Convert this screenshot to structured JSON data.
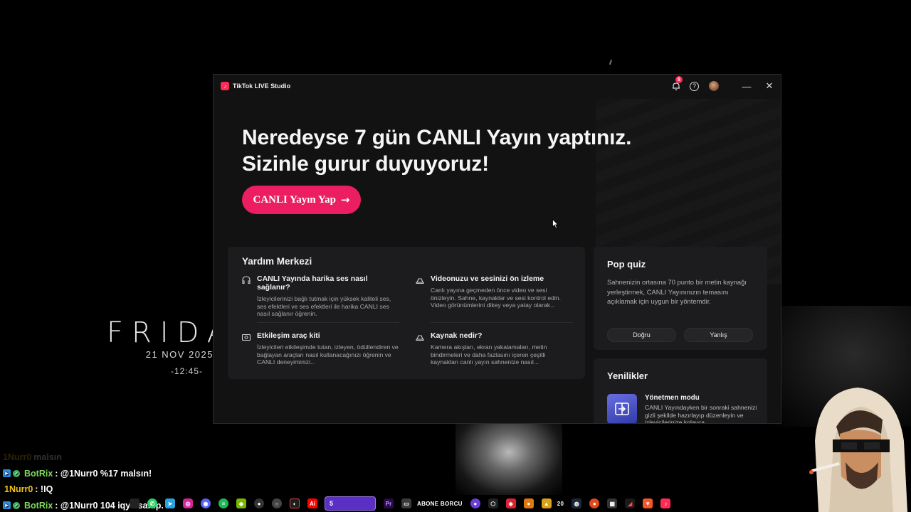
{
  "desktop": {
    "day_text": "FRIDA",
    "date_text": "21 NOV 2025",
    "time_text": "-12:45-"
  },
  "chat": {
    "lines": [
      {
        "user": "1Nurr0",
        "message": "malsın",
        "faded": true
      },
      {
        "user": "BotRix",
        "message": ": @1Nurr0 %17 malsın!"
      },
      {
        "user": "1Nurr0",
        "message": ": !IQ"
      },
      {
        "user": "BotRix",
        "message": ": @1Nurr0 104 iqye sahip."
      }
    ]
  },
  "taskbar": {
    "workspace_label": "5",
    "stream_label": "ABONE BORCU",
    "counter_label": "20"
  },
  "window": {
    "app_title": "TikTok LIVE Studio",
    "notification_count": "5",
    "help_glyph": "?",
    "minimize_glyph": "—",
    "close_glyph": "✕"
  },
  "hero": {
    "line1": "Neredeyse 7 gün CANLI Yayın yaptınız.",
    "line2": "Sizinle gurur duyuyoruz!",
    "cta_label": "CANLI Yayın Yap",
    "cta_arrow": "→"
  },
  "help_center": {
    "title": "Yardım Merkezi",
    "items": [
      {
        "icon": "headset-icon",
        "title": "CANLI Yayında harika ses nasıl sağlanır?",
        "desc": "İzleyicilerinizi bağlı tutmak için yüksek kaliteli ses, ses efektleri ve ses efektleri ile harika CANLI ses nasıl sağlanır öğrenin."
      },
      {
        "icon": "preview-icon",
        "title": "Videonuzu ve sesinizi ön izleme",
        "desc": "Canlı yayına geçmeden önce video ve sesi önizleyin. Sahne, kaynaklar ve sesi kontrol edin. Video görünümlerini dikey veya yatay olarak..."
      },
      {
        "icon": "toolkit-icon",
        "title": "Etkileşim araç kiti",
        "desc": "İzleyicileri etkileşimde tutan, izleyen, ödüllendiren ve bağlayan araçları nasıl kullanacağınızı öğrenin ve CANLI deneyiminizi..."
      },
      {
        "icon": "source-icon",
        "title": "Kaynak nedir?",
        "desc": "Kamera akışları, ekran yakalamaları, metin bindirmeleri ve daha fazlasını içeren çeşitli kaynakları canlı yayın sahnenize nasıl..."
      }
    ]
  },
  "quiz": {
    "title": "Pop quiz",
    "question": "Sahnenizin ortasına 70 punto bir metin kaynağı yerleştirmek, CANLI Yayınınızın temasını açıklamak için uygun bir yöntemdir.",
    "true_label": "Doğru",
    "false_label": "Yanlış"
  },
  "news": {
    "title": "Yenilikler",
    "item_title": "Yönetmen modu",
    "item_desc": "CANLI Yayındayken bir sonraki sahnenizi gizli şekilde hazırlayıp düzenleyin ve izleyicilerinize kolayca..."
  },
  "colors": {
    "accent": "#ea1e61",
    "tiktok_red": "#fe2c55",
    "card_bg": "#1c1c1e",
    "window_bg": "#121212"
  }
}
